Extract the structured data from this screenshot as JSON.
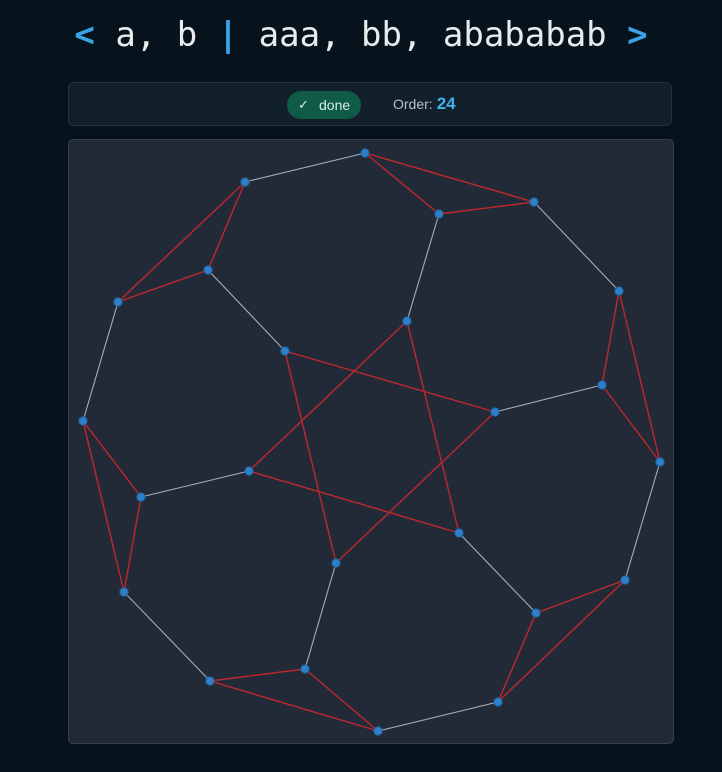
{
  "heading": {
    "open_bracket": "<",
    "generators": " a, b ",
    "separator": "|",
    "relations": " aaa, bb, abababab ",
    "close_bracket": ">"
  },
  "status": {
    "badge_icon": "check-icon",
    "badge_label": "done",
    "order_label": "Order:",
    "order_value": "24"
  },
  "colors": {
    "page_background": "#06121c",
    "panel_background": "#222a38",
    "accent": "#3aa3e6",
    "generator_a_edge": "#c0272d",
    "generator_b_edge": "#a7adb6",
    "vertex": "#2f80c8"
  }
}
